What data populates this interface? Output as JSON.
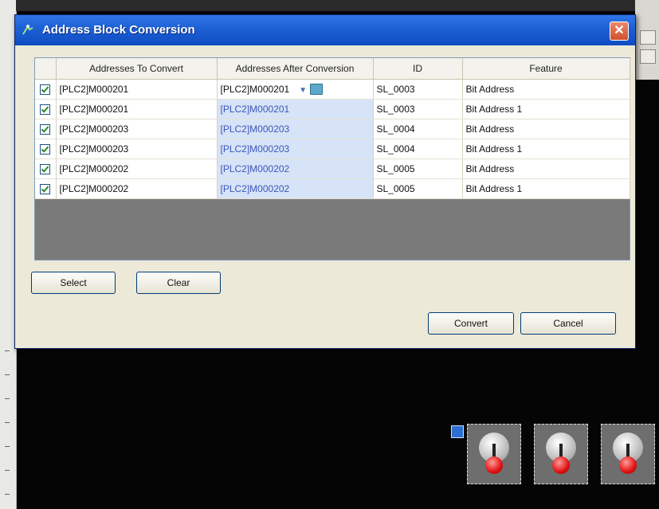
{
  "dialog": {
    "title": "Address Block Conversion",
    "close_label": "✕"
  },
  "grid": {
    "headers": {
      "convert": "Addresses To Convert",
      "after": "Addresses After Conversion",
      "id": "ID",
      "feature": "Feature"
    },
    "rows": [
      {
        "checked": true,
        "convert": "[PLC2]M000201",
        "after": "[PLC2]M000201",
        "id": "SL_0003",
        "feature": "Bit Address"
      },
      {
        "checked": true,
        "convert": "[PLC2]M000201",
        "after": "[PLC2]M000201",
        "id": "SL_0003",
        "feature": "Bit Address 1"
      },
      {
        "checked": true,
        "convert": "[PLC2]M000203",
        "after": "[PLC2]M000203",
        "id": "SL_0004",
        "feature": "Bit Address"
      },
      {
        "checked": true,
        "convert": "[PLC2]M000203",
        "after": "[PLC2]M000203",
        "id": "SL_0004",
        "feature": "Bit Address 1"
      },
      {
        "checked": true,
        "convert": "[PLC2]M000202",
        "after": "[PLC2]M000202",
        "id": "SL_0005",
        "feature": "Bit Address"
      },
      {
        "checked": true,
        "convert": "[PLC2]M000202",
        "after": "[PLC2]M000202",
        "id": "SL_0005",
        "feature": "Bit Address 1"
      }
    ]
  },
  "buttons": {
    "select": "Select",
    "clear": "Clear",
    "convert": "Convert",
    "cancel": "Cancel"
  },
  "colors": {
    "titlebar": "#1d5fd4",
    "dialog_bg": "#ece9d8",
    "after_cell_bg": "#d7e3f7"
  },
  "icons": {
    "title": "address-conversion-icon",
    "dropdown": "chevron-down-icon",
    "browse": "address-browse-icon"
  }
}
